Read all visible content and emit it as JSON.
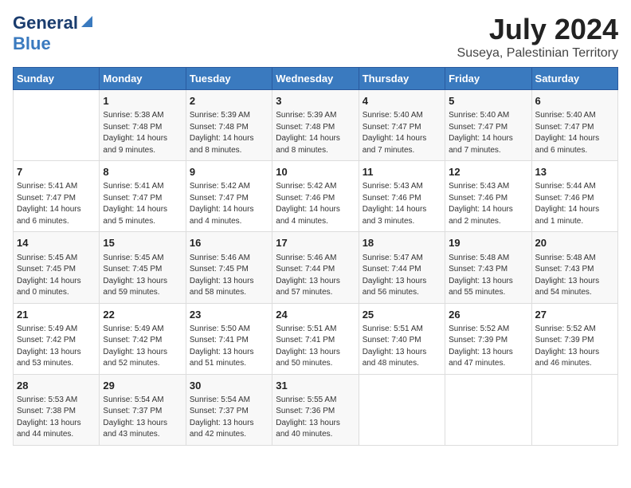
{
  "logo": {
    "general": "General",
    "blue": "Blue"
  },
  "title": "July 2024",
  "subtitle": "Suseya, Palestinian Territory",
  "days_header": [
    "Sunday",
    "Monday",
    "Tuesday",
    "Wednesday",
    "Thursday",
    "Friday",
    "Saturday"
  ],
  "weeks": [
    [
      {
        "day": "",
        "content": ""
      },
      {
        "day": "1",
        "content": "Sunrise: 5:38 AM\nSunset: 7:48 PM\nDaylight: 14 hours\nand 9 minutes."
      },
      {
        "day": "2",
        "content": "Sunrise: 5:39 AM\nSunset: 7:48 PM\nDaylight: 14 hours\nand 8 minutes."
      },
      {
        "day": "3",
        "content": "Sunrise: 5:39 AM\nSunset: 7:48 PM\nDaylight: 14 hours\nand 8 minutes."
      },
      {
        "day": "4",
        "content": "Sunrise: 5:40 AM\nSunset: 7:47 PM\nDaylight: 14 hours\nand 7 minutes."
      },
      {
        "day": "5",
        "content": "Sunrise: 5:40 AM\nSunset: 7:47 PM\nDaylight: 14 hours\nand 7 minutes."
      },
      {
        "day": "6",
        "content": "Sunrise: 5:40 AM\nSunset: 7:47 PM\nDaylight: 14 hours\nand 6 minutes."
      }
    ],
    [
      {
        "day": "7",
        "content": "Sunrise: 5:41 AM\nSunset: 7:47 PM\nDaylight: 14 hours\nand 6 minutes."
      },
      {
        "day": "8",
        "content": "Sunrise: 5:41 AM\nSunset: 7:47 PM\nDaylight: 14 hours\nand 5 minutes."
      },
      {
        "day": "9",
        "content": "Sunrise: 5:42 AM\nSunset: 7:47 PM\nDaylight: 14 hours\nand 4 minutes."
      },
      {
        "day": "10",
        "content": "Sunrise: 5:42 AM\nSunset: 7:46 PM\nDaylight: 14 hours\nand 4 minutes."
      },
      {
        "day": "11",
        "content": "Sunrise: 5:43 AM\nSunset: 7:46 PM\nDaylight: 14 hours\nand 3 minutes."
      },
      {
        "day": "12",
        "content": "Sunrise: 5:43 AM\nSunset: 7:46 PM\nDaylight: 14 hours\nand 2 minutes."
      },
      {
        "day": "13",
        "content": "Sunrise: 5:44 AM\nSunset: 7:46 PM\nDaylight: 14 hours\nand 1 minute."
      }
    ],
    [
      {
        "day": "14",
        "content": "Sunrise: 5:45 AM\nSunset: 7:45 PM\nDaylight: 14 hours\nand 0 minutes."
      },
      {
        "day": "15",
        "content": "Sunrise: 5:45 AM\nSunset: 7:45 PM\nDaylight: 13 hours\nand 59 minutes."
      },
      {
        "day": "16",
        "content": "Sunrise: 5:46 AM\nSunset: 7:45 PM\nDaylight: 13 hours\nand 58 minutes."
      },
      {
        "day": "17",
        "content": "Sunrise: 5:46 AM\nSunset: 7:44 PM\nDaylight: 13 hours\nand 57 minutes."
      },
      {
        "day": "18",
        "content": "Sunrise: 5:47 AM\nSunset: 7:44 PM\nDaylight: 13 hours\nand 56 minutes."
      },
      {
        "day": "19",
        "content": "Sunrise: 5:48 AM\nSunset: 7:43 PM\nDaylight: 13 hours\nand 55 minutes."
      },
      {
        "day": "20",
        "content": "Sunrise: 5:48 AM\nSunset: 7:43 PM\nDaylight: 13 hours\nand 54 minutes."
      }
    ],
    [
      {
        "day": "21",
        "content": "Sunrise: 5:49 AM\nSunset: 7:42 PM\nDaylight: 13 hours\nand 53 minutes."
      },
      {
        "day": "22",
        "content": "Sunrise: 5:49 AM\nSunset: 7:42 PM\nDaylight: 13 hours\nand 52 minutes."
      },
      {
        "day": "23",
        "content": "Sunrise: 5:50 AM\nSunset: 7:41 PM\nDaylight: 13 hours\nand 51 minutes."
      },
      {
        "day": "24",
        "content": "Sunrise: 5:51 AM\nSunset: 7:41 PM\nDaylight: 13 hours\nand 50 minutes."
      },
      {
        "day": "25",
        "content": "Sunrise: 5:51 AM\nSunset: 7:40 PM\nDaylight: 13 hours\nand 48 minutes."
      },
      {
        "day": "26",
        "content": "Sunrise: 5:52 AM\nSunset: 7:39 PM\nDaylight: 13 hours\nand 47 minutes."
      },
      {
        "day": "27",
        "content": "Sunrise: 5:52 AM\nSunset: 7:39 PM\nDaylight: 13 hours\nand 46 minutes."
      }
    ],
    [
      {
        "day": "28",
        "content": "Sunrise: 5:53 AM\nSunset: 7:38 PM\nDaylight: 13 hours\nand 44 minutes."
      },
      {
        "day": "29",
        "content": "Sunrise: 5:54 AM\nSunset: 7:37 PM\nDaylight: 13 hours\nand 43 minutes."
      },
      {
        "day": "30",
        "content": "Sunrise: 5:54 AM\nSunset: 7:37 PM\nDaylight: 13 hours\nand 42 minutes."
      },
      {
        "day": "31",
        "content": "Sunrise: 5:55 AM\nSunset: 7:36 PM\nDaylight: 13 hours\nand 40 minutes."
      },
      {
        "day": "",
        "content": ""
      },
      {
        "day": "",
        "content": ""
      },
      {
        "day": "",
        "content": ""
      }
    ]
  ]
}
